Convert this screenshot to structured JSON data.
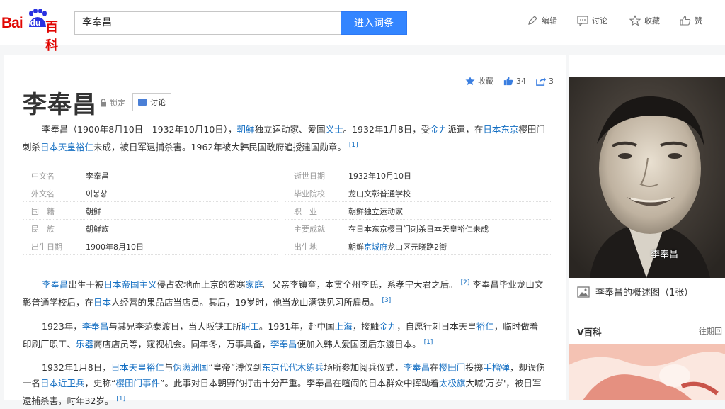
{
  "header": {
    "logo_bai": "Bai",
    "logo_du": "du",
    "logo_baike": "百科",
    "search_value": "李奉昌",
    "search_button": "进入词条",
    "tools": [
      {
        "icon": "edit-icon",
        "label": "编辑"
      },
      {
        "icon": "discussion-icon",
        "label": "讨论"
      },
      {
        "icon": "star-icon",
        "label": "收藏"
      },
      {
        "icon": "thumbs-up-icon",
        "label": "赞"
      }
    ]
  },
  "actions": {
    "favorite": "收藏",
    "likes": "34",
    "shares": "3"
  },
  "entry": {
    "title": "李奉昌",
    "lock_label": "锁定",
    "discuss_label": "讨论",
    "summary": [
      {
        "t": "李奉昌（1900年8月10日—1932年10月10日），"
      },
      {
        "t": "朝鲜",
        "link": true
      },
      {
        "t": "独立运动家、爱国"
      },
      {
        "t": "义士",
        "link": true
      },
      {
        "t": "。1932年1月8日，受"
      },
      {
        "t": "金九",
        "link": true
      },
      {
        "t": "派遣，在"
      },
      {
        "t": "日本东京",
        "link": true
      },
      {
        "t": "樱田门刺杀"
      },
      {
        "t": "日本天皇裕仁",
        "link": true
      },
      {
        "t": "未成，被日军逮捕杀害。1962年被大韩民国政府追授建国勋章。"
      },
      {
        "t": "[1]",
        "sup": true
      }
    ]
  },
  "infobox": {
    "left": [
      {
        "k": "中文名",
        "v": "李奉昌"
      },
      {
        "k": "外文名",
        "v": "이봉창"
      },
      {
        "k": "国　籍",
        "v": "朝鲜",
        "link": true
      },
      {
        "k": "民　族",
        "v": "朝鲜族"
      },
      {
        "k": "出生日期",
        "v": "1900年8月10日"
      }
    ],
    "right": [
      {
        "k": "逝世日期",
        "v": "1932年10月10日"
      },
      {
        "k": "毕业院校",
        "v": "龙山文彰普通学校"
      },
      {
        "k": "职　业",
        "v": "朝鲜独立运动家"
      },
      {
        "k": "主要成就",
        "v": "在日本东京樱田门刺杀日本天皇裕仁未成"
      },
      {
        "k": "出生地",
        "v_parts": [
          {
            "t": "朝鲜"
          },
          {
            "t": "京城府",
            "link": true
          },
          {
            "t": "龙山区元晓路2街"
          }
        ]
      }
    ]
  },
  "body": [
    [
      {
        "t": "李奉昌",
        "link": true
      },
      {
        "t": "出生于被"
      },
      {
        "t": "日本帝国主义",
        "link": true
      },
      {
        "t": "侵占农地而上京的贫寒"
      },
      {
        "t": "家庭",
        "link": true
      },
      {
        "t": "。父亲李镇奎，本贯全州李氏，系孝宁大君之后。"
      },
      {
        "t": "[2]",
        "sup": true
      },
      {
        "t": " 李奉昌毕业龙山文彰普通学校后，在"
      },
      {
        "t": "日本",
        "link": true
      },
      {
        "t": "人经营的果品店当店员。其后，19岁时，他当龙山满铁见习所雇员。"
      },
      {
        "t": "[3]",
        "sup": true
      }
    ],
    [
      {
        "t": "1923年，"
      },
      {
        "t": "李奉昌",
        "link": true
      },
      {
        "t": "与其兄李范泰渡日，当大阪铁工所"
      },
      {
        "t": "职工",
        "link": true
      },
      {
        "t": "。1931年，赴中国"
      },
      {
        "t": "上海",
        "link": true
      },
      {
        "t": "，接触"
      },
      {
        "t": "金九",
        "link": true
      },
      {
        "t": "，自愿行刺日本天皇"
      },
      {
        "t": "裕仁",
        "link": true
      },
      {
        "t": "，临时做着印刷厂职工、"
      },
      {
        "t": "乐器",
        "link": true
      },
      {
        "t": "商店店员等，窥视机会。同年冬，万事具备，"
      },
      {
        "t": "李奉昌",
        "link": true
      },
      {
        "t": "便加入韩人爱国团后东渡日本。"
      },
      {
        "t": "[1]",
        "sup": true
      }
    ],
    [
      {
        "t": "1932年1月8日，"
      },
      {
        "t": "日本天皇裕仁",
        "link": true
      },
      {
        "t": "与"
      },
      {
        "t": "伪满洲国",
        "link": true
      },
      {
        "t": "“皇帝”溥仪到"
      },
      {
        "t": "东京代代木练兵",
        "link": true
      },
      {
        "t": "场所参加阅兵仪式，"
      },
      {
        "t": "李奉昌",
        "link": true
      },
      {
        "t": "在"
      },
      {
        "t": "樱田门",
        "link": true
      },
      {
        "t": "投掷"
      },
      {
        "t": "手榴弹",
        "link": true
      },
      {
        "t": "，却误伤一名"
      },
      {
        "t": "日本近卫兵",
        "link": true
      },
      {
        "t": "，史称“"
      },
      {
        "t": "樱田门事件",
        "link": true
      },
      {
        "t": "”。此事对日本朝野的打击十分严重。李奉昌在喧闹的日本群众中挥动着"
      },
      {
        "t": "太极旗",
        "link": true
      },
      {
        "t": "大喊'万岁'，被日军逮捕杀害，时年32岁。"
      },
      {
        "t": "[1]",
        "sup": true
      }
    ]
  ],
  "sidebar": {
    "photo_caption": "李奉昌",
    "album_label": "李奉昌的概述图（1张）",
    "vbaike_title": "V百科",
    "vbaike_more": "往期回"
  }
}
